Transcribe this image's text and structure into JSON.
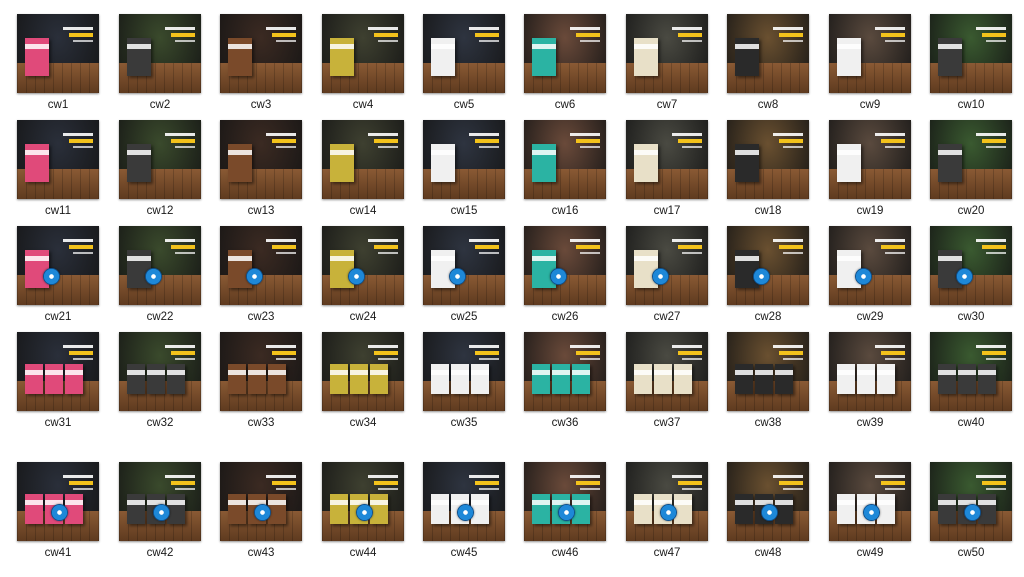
{
  "files": [
    {
      "name": "cw1",
      "bg": "#2a2f3a"
    },
    {
      "name": "cw2",
      "bg": "#3a4a2c"
    },
    {
      "name": "cw3",
      "bg": "#3b2a22"
    },
    {
      "name": "cw4",
      "bg": "#3e4030"
    },
    {
      "name": "cw5",
      "bg": "#2e3440"
    },
    {
      "name": "cw6",
      "bg": "#6a4a3a"
    },
    {
      "name": "cw7",
      "bg": "#4a4a42"
    },
    {
      "name": "cw8",
      "bg": "#6a5030"
    },
    {
      "name": "cw9",
      "bg": "#5a4a3e"
    },
    {
      "name": "cw10",
      "bg": "#3a5a30"
    },
    {
      "name": "cw11",
      "bg": "#2a2f3a"
    },
    {
      "name": "cw12",
      "bg": "#3a4a2c"
    },
    {
      "name": "cw13",
      "bg": "#3b2a22"
    },
    {
      "name": "cw14",
      "bg": "#3e4030"
    },
    {
      "name": "cw15",
      "bg": "#2e3440"
    },
    {
      "name": "cw16",
      "bg": "#6a4a3a"
    },
    {
      "name": "cw17",
      "bg": "#4a4a42"
    },
    {
      "name": "cw18",
      "bg": "#6a5030"
    },
    {
      "name": "cw19",
      "bg": "#5a4a3e"
    },
    {
      "name": "cw20",
      "bg": "#3a5a30"
    },
    {
      "name": "cw21",
      "bg": "#2a2f3a"
    },
    {
      "name": "cw22",
      "bg": "#3a4a2c"
    },
    {
      "name": "cw23",
      "bg": "#3b2a22"
    },
    {
      "name": "cw24",
      "bg": "#3e4030"
    },
    {
      "name": "cw25",
      "bg": "#2e3440"
    },
    {
      "name": "cw26",
      "bg": "#6a4a3a"
    },
    {
      "name": "cw27",
      "bg": "#4a4a42"
    },
    {
      "name": "cw28",
      "bg": "#6a5030"
    },
    {
      "name": "cw29",
      "bg": "#5a4a3e"
    },
    {
      "name": "cw30",
      "bg": "#3a5a30"
    },
    {
      "name": "cw31",
      "bg": "#2a2f3a"
    },
    {
      "name": "cw32",
      "bg": "#3a4a2c"
    },
    {
      "name": "cw33",
      "bg": "#3b2a22"
    },
    {
      "name": "cw34",
      "bg": "#3e4030"
    },
    {
      "name": "cw35",
      "bg": "#2e3440"
    },
    {
      "name": "cw36",
      "bg": "#6a4a3a"
    },
    {
      "name": "cw37",
      "bg": "#4a4a42"
    },
    {
      "name": "cw38",
      "bg": "#6a5030"
    },
    {
      "name": "cw39",
      "bg": "#5a4a3e"
    },
    {
      "name": "cw40",
      "bg": "#3a5a30"
    },
    {
      "name": "cw41",
      "bg": "#2a2f3a"
    },
    {
      "name": "cw42",
      "bg": "#3a4a2c"
    },
    {
      "name": "cw43",
      "bg": "#3b2a22"
    },
    {
      "name": "cw44",
      "bg": "#3e4030"
    },
    {
      "name": "cw45",
      "bg": "#2e3440"
    },
    {
      "name": "cw46",
      "bg": "#6a4a3a"
    },
    {
      "name": "cw47",
      "bg": "#4a4a42"
    },
    {
      "name": "cw48",
      "bg": "#6a5030"
    },
    {
      "name": "cw49",
      "bg": "#5a4a3e"
    },
    {
      "name": "cw50",
      "bg": "#3a5a30"
    }
  ],
  "box_colors": [
    "#e04a7a",
    "#3a3a3a",
    "#7a4a2a",
    "#c8b23a",
    "#f0f0f0",
    "#2bb3a3",
    "#e8e0c8",
    "#2a2a2a",
    "#f0f0f0",
    "#3a3a3a"
  ]
}
